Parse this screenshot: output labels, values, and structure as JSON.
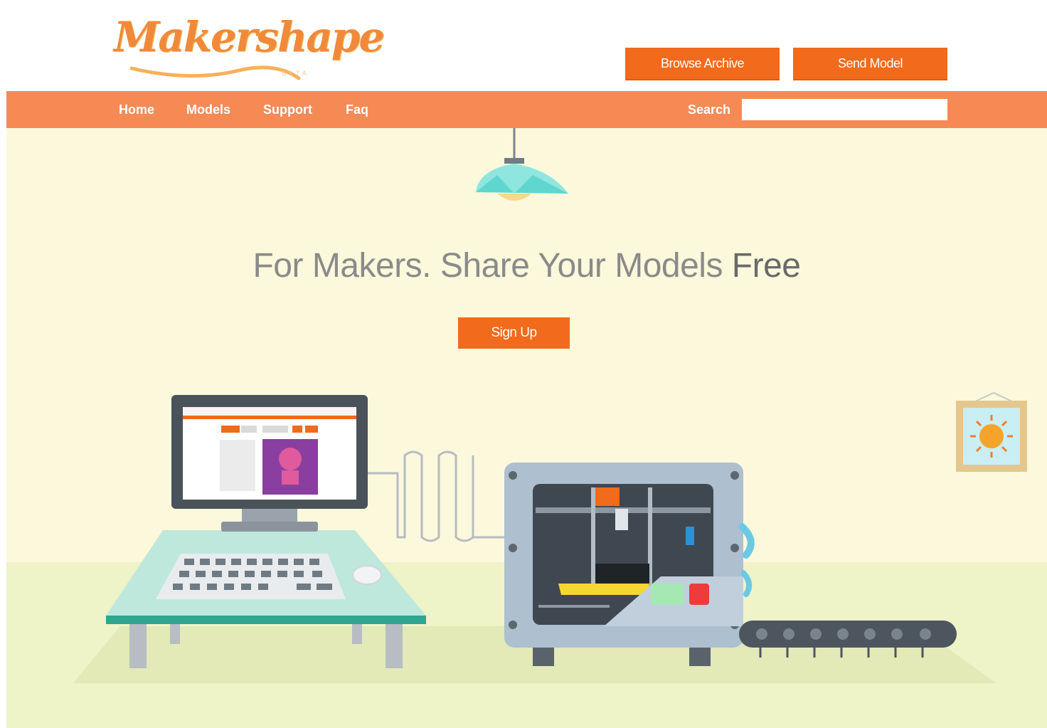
{
  "brand": {
    "logo_text": "Makershape",
    "beta_tag": "BETA"
  },
  "header": {
    "browse_label": "Browse Archive",
    "send_label": "Send Model"
  },
  "nav": {
    "items": [
      {
        "label": "Home"
      },
      {
        "label": "Models"
      },
      {
        "label": "Support"
      },
      {
        "label": "Faq"
      }
    ],
    "search_label": "Search",
    "search_value": "",
    "search_placeholder": ""
  },
  "hero": {
    "headline_main": "For Makers. Share Your Models ",
    "headline_emphasis": "Free",
    "signup_label": "Sign Up"
  },
  "colors": {
    "accent": "#f26a1b",
    "nav_bar": "#f68a55",
    "hero_bg": "#fcf8dc",
    "floor": "#eef3c8"
  },
  "icons": [
    "lamp-icon",
    "computer-illustration",
    "printer-illustration",
    "sun-picture-icon",
    "conveyor-illustration"
  ]
}
